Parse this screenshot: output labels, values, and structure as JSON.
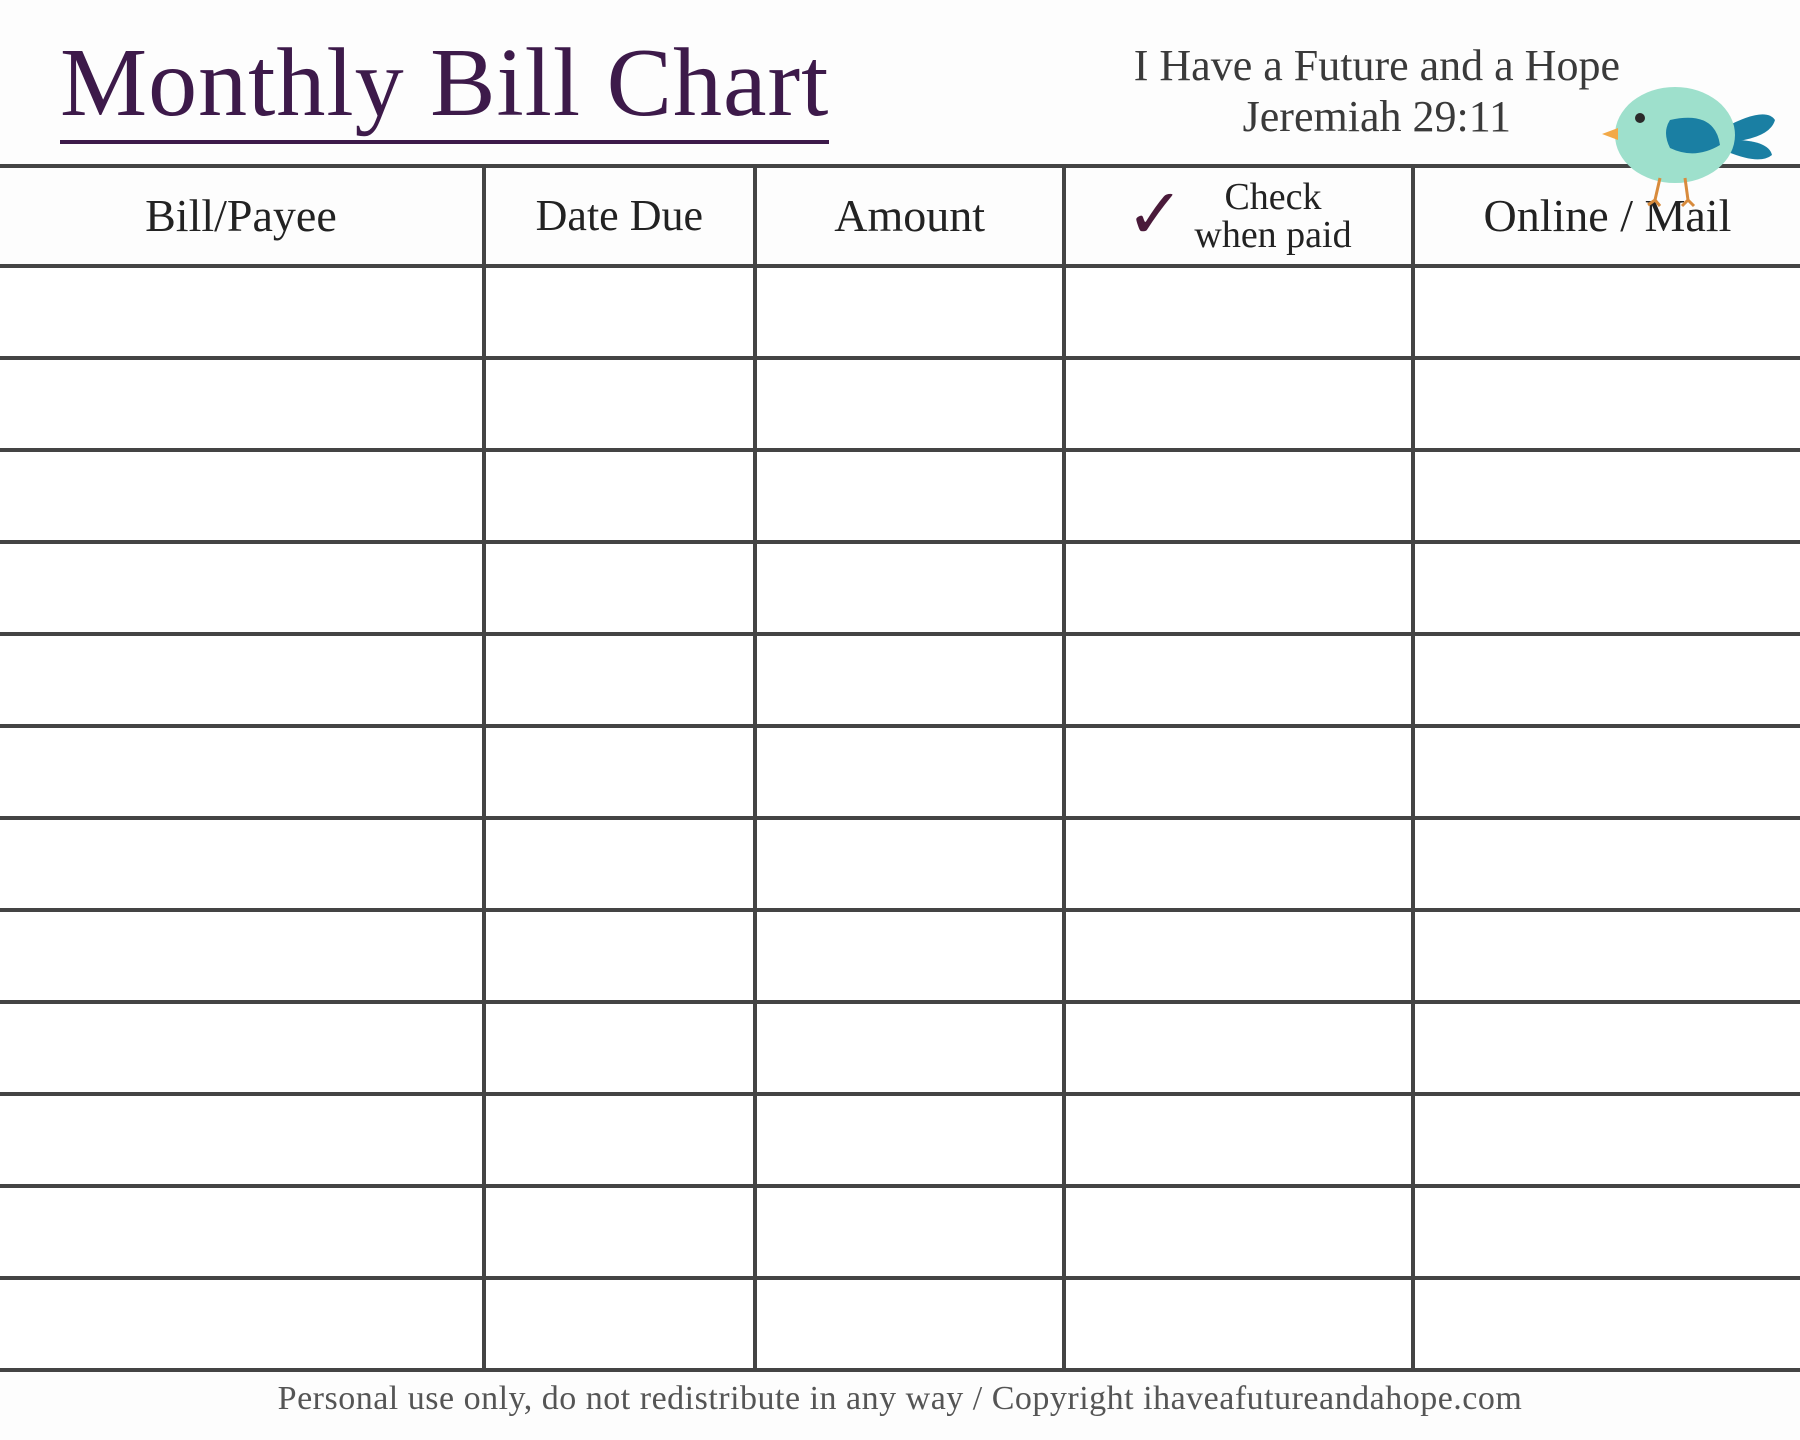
{
  "header": {
    "title": "Monthly Bill Chart",
    "tagline_line1": "I Have a Future and a Hope",
    "tagline_line2": "Jeremiah 29:11"
  },
  "columns": {
    "bill_payee": "Bill/Payee",
    "date_due": "Date Due",
    "amount": "Amount",
    "check_line1": "Check",
    "check_line2": "when paid",
    "online_mail": "Online / Mail"
  },
  "row_count": 12,
  "footer": "Personal use only, do not redistribute in any way / Copyright ihaveafutureandahope.com",
  "colors": {
    "title": "#3d1a4a",
    "border": "#444444",
    "checkmark": "#4a1a3a",
    "bird_body": "#9ee0cc",
    "bird_wing": "#1a7fa3",
    "bird_tail": "#1a7fa3",
    "bird_beak": "#f2a948",
    "bird_legs": "#d88b3c"
  },
  "icons": {
    "checkmark": "✓",
    "bird": "bird-icon"
  }
}
